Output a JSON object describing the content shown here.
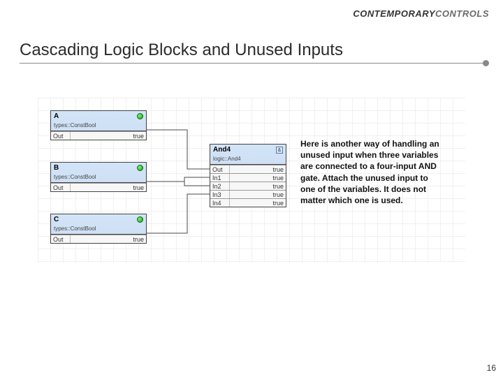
{
  "logo": {
    "part1": "CONTEMPORARY",
    "part2": "CONTROLS"
  },
  "title": "Cascading Logic Blocks and Unused Inputs",
  "page_number": "16",
  "description": "Here is another way of handling an unused input when three variables are connected to a four-input AND gate.  Attach the unused input to one of the variables.  It does not matter which one is used.",
  "blocks": {
    "A": {
      "name": "A",
      "type": "types::ConstBool",
      "rows": [
        {
          "label": "Out",
          "value": "true"
        }
      ]
    },
    "B": {
      "name": "B",
      "type": "types::ConstBool",
      "rows": [
        {
          "label": "Out",
          "value": "true"
        }
      ]
    },
    "C": {
      "name": "C",
      "type": "types::ConstBool",
      "rows": [
        {
          "label": "Out",
          "value": "true"
        }
      ]
    },
    "And4": {
      "name": "And4",
      "type": "logic::And4",
      "rows": [
        {
          "label": "Out",
          "value": "true"
        },
        {
          "label": "In1",
          "value": "true"
        },
        {
          "label": "In2",
          "value": "true"
        },
        {
          "label": "In3",
          "value": "true"
        },
        {
          "label": "In4",
          "value": "true"
        }
      ]
    }
  }
}
